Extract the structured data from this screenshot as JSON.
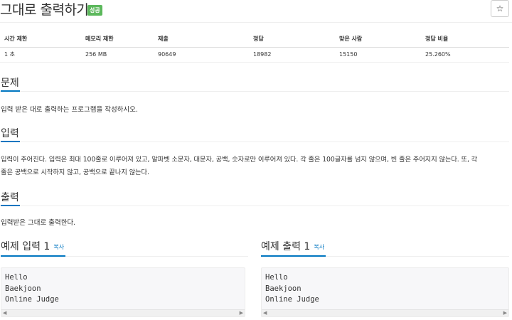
{
  "problem": {
    "title": "그대로 출력하기",
    "badge": "성공",
    "star_icon": "☆"
  },
  "info_table": {
    "headers": [
      "시간 제한",
      "메모리 제한",
      "제출",
      "정답",
      "맞은 사람",
      "정답 비율"
    ],
    "values": [
      "1 초",
      "256 MB",
      "90649",
      "18982",
      "15150",
      "25.260%"
    ]
  },
  "sections": {
    "description": {
      "heading": "문제",
      "text": "입력 받은 대로 출력하는 프로그램을 작성하시오."
    },
    "input": {
      "heading": "입력",
      "text_line1": "입력이 주어진다. 입력은 최대 100줄로 이루어져 있고, 알파벳 소문자, 대문자, 공백, 숫자로만 이루어져 있다. 각 줄은 100글자를 넘지 않으며, 빈 줄은 주어지지 않는다. 또, 각",
      "text_line2": "줄은 공백으로 시작하지 않고, 공백으로 끝나지 않는다."
    },
    "output": {
      "heading": "출력",
      "text": "입력받은 그대로 출력한다."
    }
  },
  "samples": {
    "input": {
      "heading": "예제 입력 1",
      "copy_label": "복사",
      "content": "Hello\nBaekjoon\nOnline Judge"
    },
    "output": {
      "heading": "예제 출력 1",
      "copy_label": "복사",
      "content": "Hello\nBaekjoon\nOnline Judge"
    }
  },
  "scrollbar": {
    "left_arrow": "◀",
    "right_arrow": "▶"
  },
  "colors": {
    "accent": "#0076c0",
    "badge": "#5cb85c"
  }
}
